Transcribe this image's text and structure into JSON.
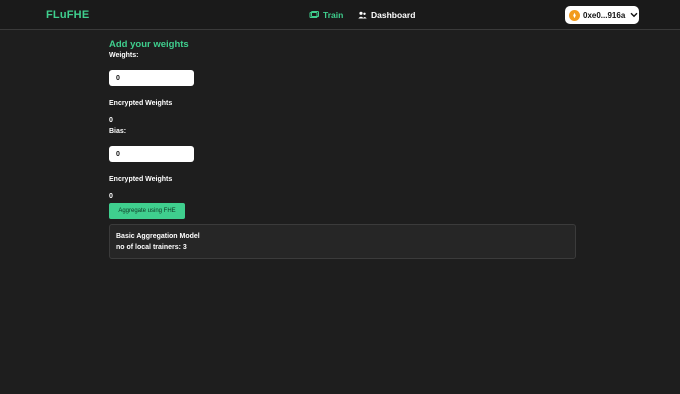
{
  "nav": {
    "logo": "FLuFHE",
    "links": [
      {
        "label": "Train",
        "icon": "train-icon",
        "active": true
      },
      {
        "label": "Dashboard",
        "icon": "people-icon",
        "active": false
      }
    ],
    "wallet": {
      "address": "0xe0...916a",
      "token_icon": "token-icon"
    }
  },
  "form": {
    "title": "Add your weights",
    "weights_label": "Weights:",
    "weights_value": "0",
    "encrypted_weights_label": "Encrypted Weights",
    "encrypted_weights_value": "0",
    "bias_label": "Bias:",
    "bias_value": "0",
    "encrypted_bias_label": "Encrypted Weights",
    "encrypted_bias_value": "0",
    "aggregate_button": "Aggregate using FHE"
  },
  "model_card": {
    "title": "Basic Aggregation Model",
    "trainers": "no of local trainers: 3"
  },
  "colors": {
    "accent": "#3fcf8e",
    "background": "#1e1e1e",
    "navbar": "#1a1a1a",
    "card": "#262626",
    "token": "#f29b1d"
  }
}
